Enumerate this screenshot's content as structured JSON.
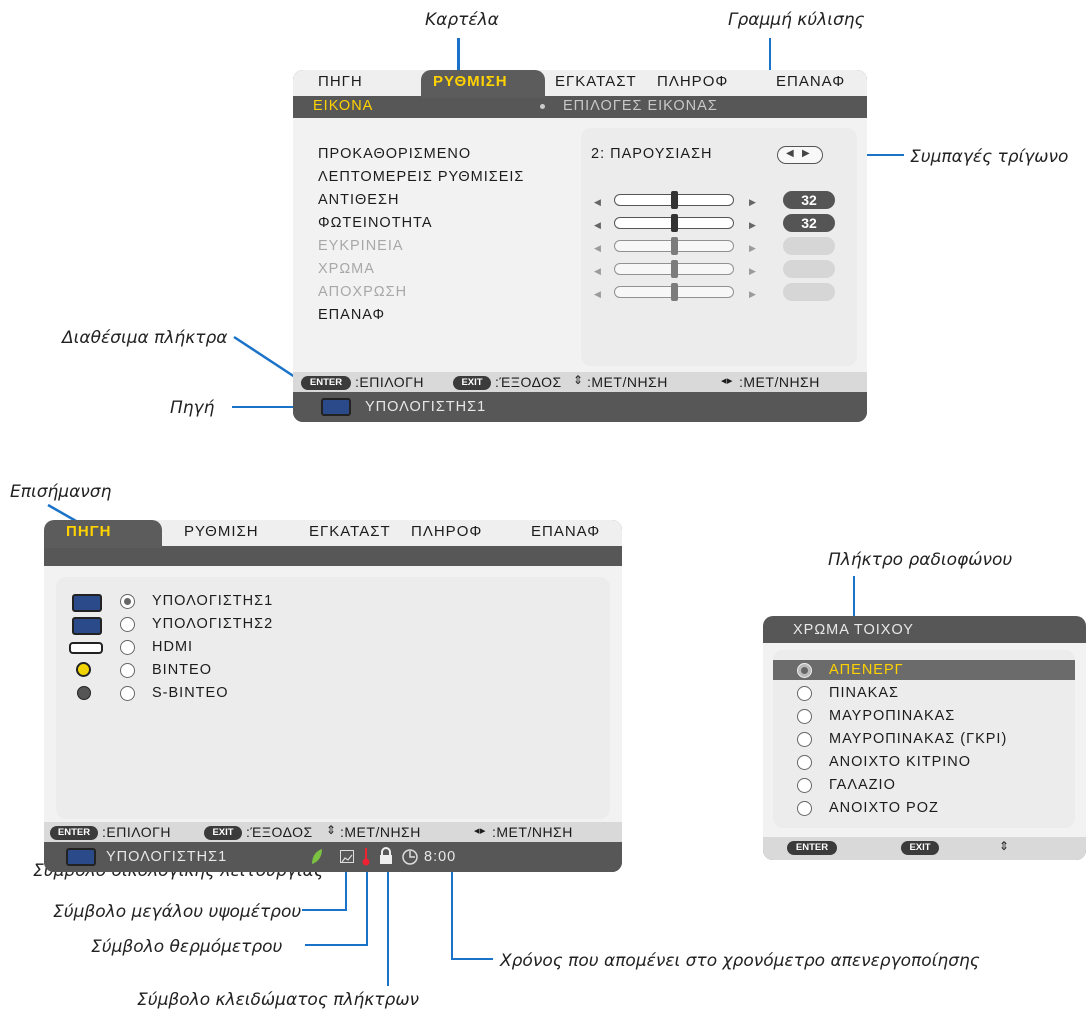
{
  "callouts": {
    "tab": "Καρτέλα",
    "scrollbar": "Γραμμή κύλισης",
    "triangle_buttons": "Συμπαγές τρίγωνο",
    "available_keys": "Διαθέσιμα πλήκτρα",
    "source": "Πηγή",
    "highlight": "Επισήμανση",
    "radio_button": "Πλήκτρο ραδιοφώνου",
    "eco_symbol": "Σύμβολο οικολογικής λειτουργίας",
    "high_altitude_symbol": "Σύμβολο μεγάλου υψομέτρου",
    "thermometer_symbol": "Σύμβολο θερμόμετρου",
    "key_lock_symbol": "Σύμβολο κλειδώματος πλήκτρων",
    "off_timer": "Χρόνος που απομένει στο χρονόμετρο απενεργοποίησης"
  },
  "menu1": {
    "tabs": [
      "ΠΗΓΗ",
      "ΡΥΘΜΙΣΗ",
      "ΕΓΚΑΤΑΣΤ",
      "ΠΛΗΡΟΦ",
      "ΕΠΑΝΑΦ"
    ],
    "active_tab": "ΡΥΘΜΙΣΗ",
    "subtabs": [
      "ΕΙΚΟΝΑ",
      "ΕΠΙΛΟΓΕΣ ΕΙΚΟΝΑΣ"
    ],
    "items": [
      "ΠΡΟΚΑΘΟΡΙΣΜΕΝΟ",
      "ΛΕΠΤΟΜΕΡΕΙΣ ΡΥΘΜΙΣΕΙΣ",
      "ΑΝΤΙΘΕΣΗ",
      "ΦΩΤΕΙΝΟΤΗΤΑ",
      "ΕΥΚΡΙΝΕΙΑ",
      "ΧΡΩΜΑ",
      "ΑΠΟΧΡΩΣΗ",
      "ΕΠΑΝΑΦ"
    ],
    "preset_value": "2:  ΠΑΡΟΥΣΙΑΣΗ",
    "contrast_value": "32",
    "brightness_value": "32",
    "keys": {
      "enter": "ENTER",
      "enter_label": ":ΕΠΙΛΟΓΗ",
      "exit": "EXIT",
      "exit_label": ":ΈΞΟΔΟΣ",
      "move_v_label": ":ΜΕΤ/ΝΗΣΗ",
      "move_h_label": ":ΜΕΤ/ΝΗΣΗ"
    },
    "source": "ΥΠΟΛΟΓΙΣΤΗΣ1"
  },
  "menu2": {
    "tabs": [
      "ΠΗΓΗ",
      "ΡΥΘΜΙΣΗ",
      "ΕΓΚΑΤΑΣΤ",
      "ΠΛΗΡΟΦ",
      "ΕΠΑΝΑΦ"
    ],
    "active_tab": "ΠΗΓΗ",
    "sources": [
      "ΥΠΟΛΟΓΙΣΤΗΣ1",
      "ΥΠΟΛΟΓΙΣΤΗΣ2",
      "HDMI",
      "ΒΙΝΤΕΟ",
      "S-ΒΙΝΤΕΟ"
    ],
    "keys": {
      "enter": "ENTER",
      "enter_label": ":ΕΠΙΛΟΓΗ",
      "exit": "EXIT",
      "exit_label": ":ΈΞΟΔΟΣ",
      "move_v_label": ":ΜΕΤ/ΝΗΣΗ",
      "move_h_label": ":ΜΕΤ/ΝΗΣΗ"
    },
    "source": "ΥΠΟΛΟΓΙΣΤΗΣ1",
    "timer": "8:00"
  },
  "menu3": {
    "title": "ΧΡΩΜΑ ΤΟΙΧΟΥ",
    "options": [
      "ΑΠΕΝΕΡΓ",
      "ΠΙΝΑΚΑΣ",
      "ΜΑΥΡΟΠΙΝΑΚΑΣ",
      "ΜΑΥΡΟΠΙΝΑΚΑΣ (ΓΚΡΙ)",
      "ΑΝΟΙΧΤΟ ΚΙΤΡΙΝΟ",
      "ΓΑΛΑΖΙΟ",
      "ΑΝΟΙΧΤΟ ΡΟΖ"
    ],
    "keys": {
      "enter": "ENTER",
      "exit": "EXIT"
    }
  }
}
